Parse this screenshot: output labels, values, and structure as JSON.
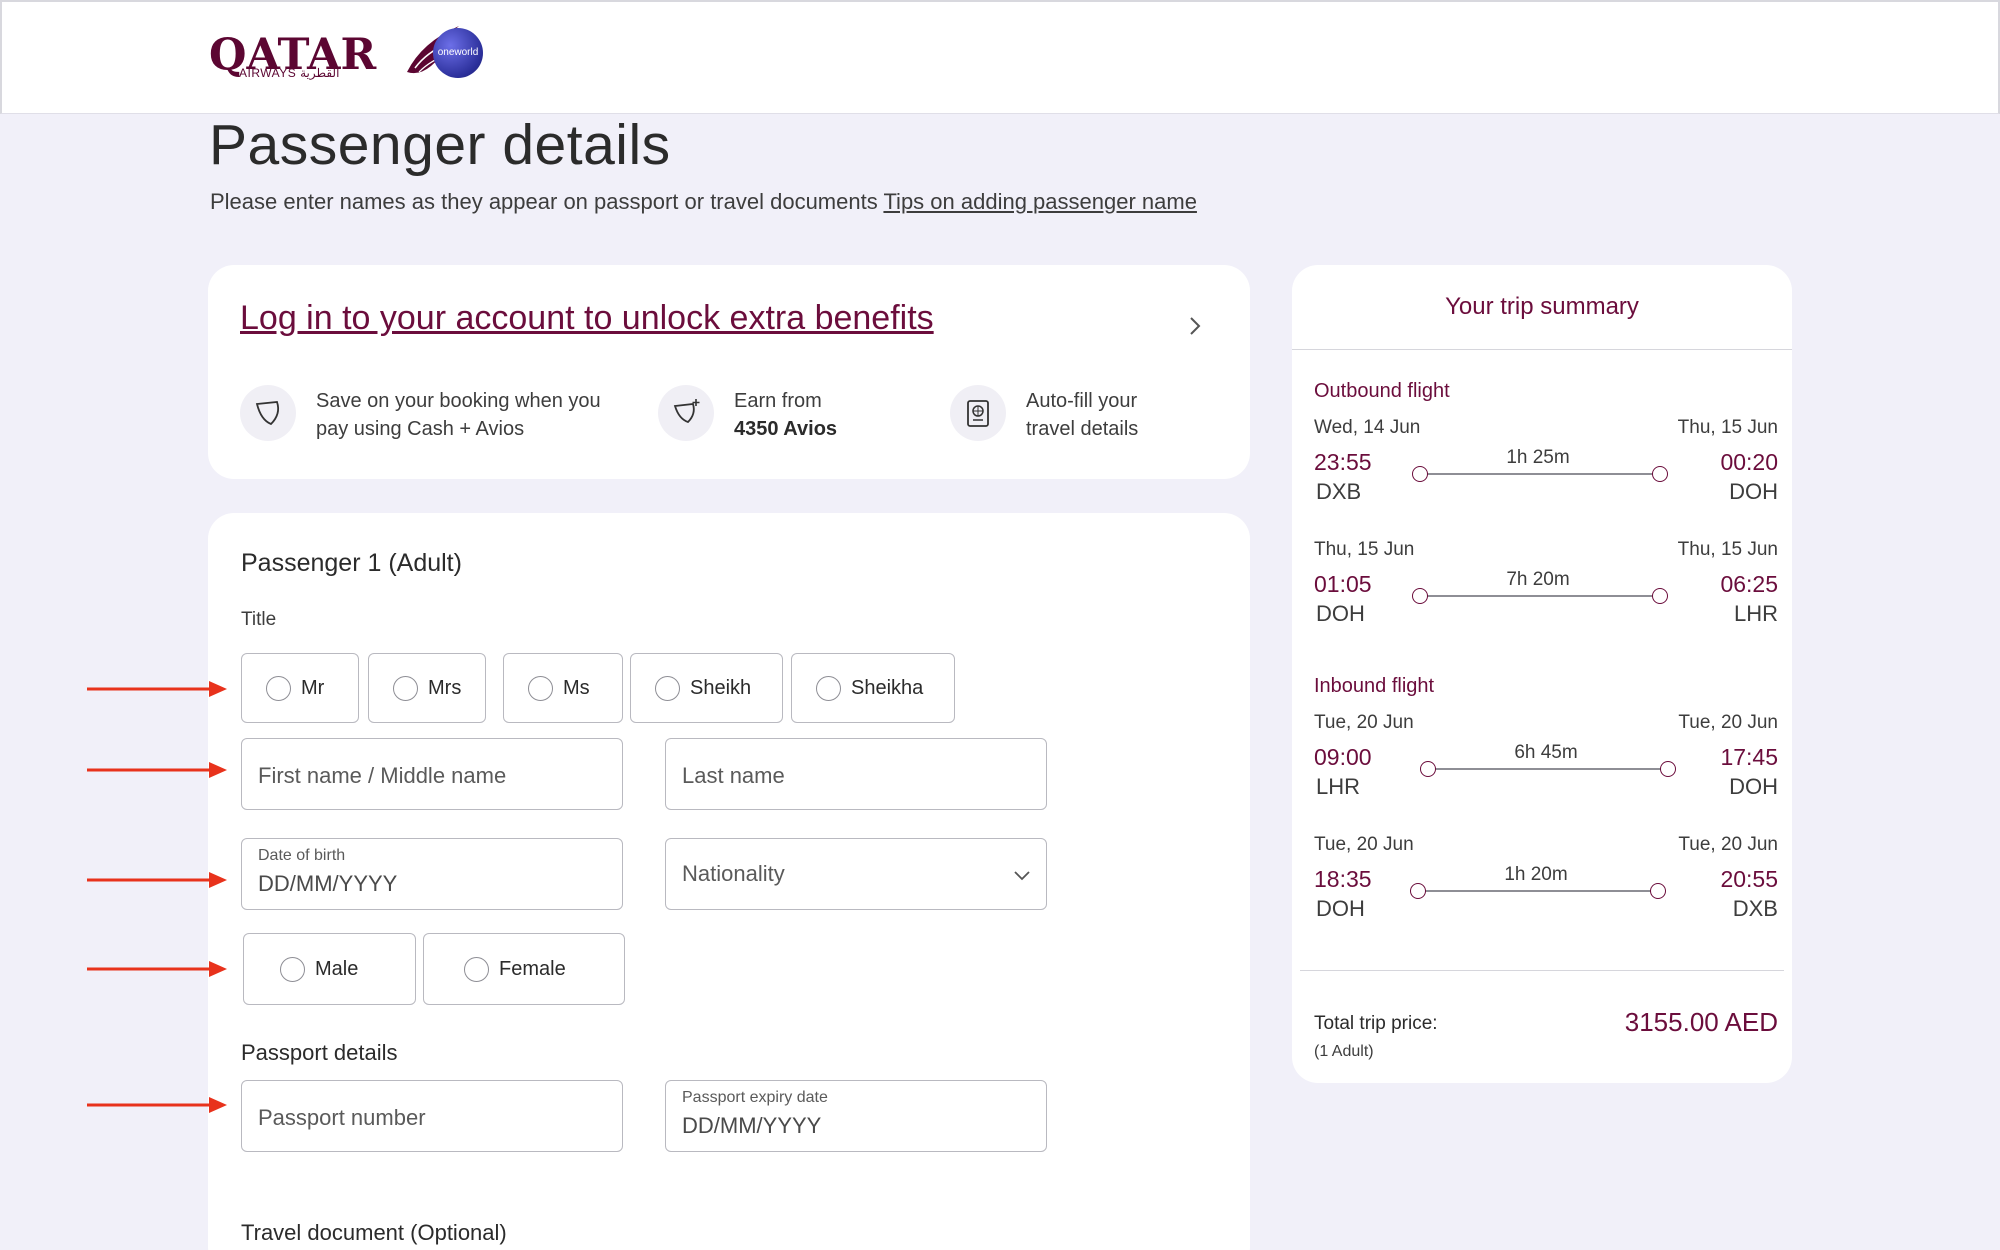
{
  "brand": {
    "name": "QATAR",
    "sub": "AIRWAYS القطرية",
    "alliance": "oneworld",
    "brand_color": "#6b0d3c",
    "arrow_color": "#e8321c"
  },
  "page": {
    "title": "Passenger details",
    "subtitle": "Please enter names as they appear on passport or travel documents",
    "tips_link": "Tips on adding passenger name"
  },
  "login": {
    "link": "Log in to your account to unlock extra benefits",
    "benefits": [
      {
        "icon": "avios-tag-icon",
        "line1": "Save on your booking when you",
        "line2": "pay using Cash + Avios",
        "bold": ""
      },
      {
        "icon": "avios-earn-icon",
        "line1": "Earn from",
        "line2": "",
        "bold": "4350 Avios"
      },
      {
        "icon": "passport-icon",
        "line1": "Auto-fill your",
        "line2": "travel details",
        "bold": ""
      }
    ]
  },
  "passenger": {
    "heading": "Passenger  1 (Adult)",
    "title_label": "Title",
    "titles": [
      "Mr",
      "Mrs",
      "Ms",
      "Sheikh",
      "Sheikha"
    ],
    "first_name_placeholder": "First name / Middle name",
    "last_name_placeholder": "Last name",
    "dob_label": "Date of birth",
    "dob_placeholder": "DD/MM/YYYY",
    "nationality_placeholder": "Nationality",
    "genders": [
      "Male",
      "Female"
    ],
    "passport_heading": "Passport details",
    "passport_number_placeholder": "Passport number",
    "passport_expiry_label": "Passport expiry date",
    "passport_expiry_placeholder": "DD/MM/YYYY",
    "travel_doc_heading": "Travel document (Optional)"
  },
  "summary": {
    "title": "Your trip summary",
    "outbound_label": "Outbound flight",
    "inbound_label": "Inbound flight",
    "outbound": [
      {
        "dep_date": "Wed, 14 Jun",
        "arr_date": "Thu, 15 Jun",
        "dep_time": "23:55",
        "arr_time": "00:20",
        "dep_code": "DXB",
        "arr_code": "DOH",
        "duration": "1h 25m"
      },
      {
        "dep_date": "Thu, 15 Jun",
        "arr_date": "Thu, 15 Jun",
        "dep_time": "01:05",
        "arr_time": "06:25",
        "dep_code": "DOH",
        "arr_code": "LHR",
        "duration": "7h 20m"
      }
    ],
    "inbound": [
      {
        "dep_date": "Tue, 20 Jun",
        "arr_date": "Tue, 20 Jun",
        "dep_time": "09:00",
        "arr_time": "17:45",
        "dep_code": "LHR",
        "arr_code": "DOH",
        "duration": "6h 45m"
      },
      {
        "dep_date": "Tue, 20 Jun",
        "arr_date": "Tue, 20 Jun",
        "dep_time": "18:35",
        "arr_time": "20:55",
        "dep_code": "DOH",
        "arr_code": "DXB",
        "duration": "1h 20m"
      }
    ],
    "total_label": "Total trip price:",
    "total_sub": "(1 Adult)",
    "total_value": "3155.00 AED"
  }
}
